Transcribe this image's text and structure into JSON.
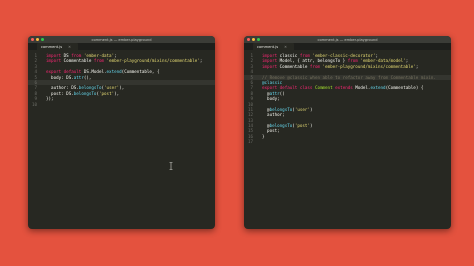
{
  "left_window": {
    "title": "comment.js — ember-playground",
    "tab": "comment.js",
    "lines": [
      [
        {
          "t": "import ",
          "c": "kw"
        },
        {
          "t": "DS ",
          "c": "p"
        },
        {
          "t": "from ",
          "c": "kw"
        },
        {
          "t": "'ember-data'",
          "c": "str"
        },
        {
          "t": ";",
          "c": "p"
        }
      ],
      [
        {
          "t": "import ",
          "c": "kw"
        },
        {
          "t": "Commentable ",
          "c": "p"
        },
        {
          "t": "from ",
          "c": "kw"
        },
        {
          "t": "'ember-playground/mixins/commentable'",
          "c": "str"
        },
        {
          "t": ";",
          "c": "p"
        }
      ],
      [],
      [
        {
          "t": "export default ",
          "c": "kw"
        },
        {
          "t": "DS.Model.",
          "c": "p"
        },
        {
          "t": "extend",
          "c": "fn"
        },
        {
          "t": "(Commentable, {",
          "c": "p"
        }
      ],
      [
        {
          "t": "  body: ",
          "c": "p"
        },
        {
          "t": "DS.",
          "c": "p"
        },
        {
          "t": "attr",
          "c": "fn"
        },
        {
          "t": "(),",
          "c": "p"
        }
      ],
      [],
      [
        {
          "t": "  author: ",
          "c": "p"
        },
        {
          "t": "DS.",
          "c": "p"
        },
        {
          "t": "belongsTo",
          "c": "fn"
        },
        {
          "t": "(",
          "c": "p"
        },
        {
          "t": "'user'",
          "c": "str"
        },
        {
          "t": "),",
          "c": "p"
        }
      ],
      [
        {
          "t": "  post: ",
          "c": "p"
        },
        {
          "t": "DS.",
          "c": "p"
        },
        {
          "t": "belongsTo",
          "c": "fn"
        },
        {
          "t": "(",
          "c": "p"
        },
        {
          "t": "'post'",
          "c": "str"
        },
        {
          "t": "),",
          "c": "p"
        }
      ],
      [
        {
          "t": "});",
          "c": "p"
        }
      ],
      []
    ],
    "highlight_line": 6
  },
  "right_window": {
    "title": "comment.js — ember-playground",
    "tab": "comment.js",
    "lines": [
      [
        {
          "t": "import ",
          "c": "kw"
        },
        {
          "t": "classic ",
          "c": "p"
        },
        {
          "t": "from ",
          "c": "kw"
        },
        {
          "t": "'ember-classic-decorator'",
          "c": "str"
        },
        {
          "t": ";",
          "c": "p"
        }
      ],
      [
        {
          "t": "import ",
          "c": "kw"
        },
        {
          "t": "Model, { attr, belongsTo } ",
          "c": "p"
        },
        {
          "t": "from ",
          "c": "kw"
        },
        {
          "t": "'ember-data/model'",
          "c": "str"
        },
        {
          "t": ";",
          "c": "p"
        }
      ],
      [
        {
          "t": "import ",
          "c": "kw"
        },
        {
          "t": "Commentable ",
          "c": "p"
        },
        {
          "t": "from ",
          "c": "kw"
        },
        {
          "t": "'ember-playground/mixins/commentable'",
          "c": "str"
        },
        {
          "t": ";",
          "c": "p"
        }
      ],
      [],
      [
        {
          "t": "// Remove @classic when able to refactor away from Commentable mixin.",
          "c": "cmt"
        }
      ],
      [
        {
          "t": "@classic",
          "c": "dec"
        }
      ],
      [
        {
          "t": "export default class ",
          "c": "kw"
        },
        {
          "t": "Comment ",
          "c": "fn2"
        },
        {
          "t": "extends ",
          "c": "kw"
        },
        {
          "t": "Model.",
          "c": "p"
        },
        {
          "t": "extend",
          "c": "fn"
        },
        {
          "t": "(Commentable) {",
          "c": "p"
        }
      ],
      [
        {
          "t": "  @",
          "c": "p"
        },
        {
          "t": "attr",
          "c": "dec"
        },
        {
          "t": "()",
          "c": "p"
        }
      ],
      [
        {
          "t": "  body;",
          "c": "p"
        }
      ],
      [],
      [
        {
          "t": "  @",
          "c": "p"
        },
        {
          "t": "belongsTo",
          "c": "dec"
        },
        {
          "t": "(",
          "c": "p"
        },
        {
          "t": "'user'",
          "c": "str"
        },
        {
          "t": ")",
          "c": "p"
        }
      ],
      [
        {
          "t": "  author;",
          "c": "p"
        }
      ],
      [],
      [
        {
          "t": "  @",
          "c": "p"
        },
        {
          "t": "belongsTo",
          "c": "dec"
        },
        {
          "t": "(",
          "c": "p"
        },
        {
          "t": "'post'",
          "c": "str"
        },
        {
          "t": ")",
          "c": "p"
        }
      ],
      [
        {
          "t": "  post;",
          "c": "p"
        }
      ],
      [
        {
          "t": "}",
          "c": "p"
        }
      ],
      []
    ],
    "highlight_line": 5
  },
  "colors": {
    "background": "#e4523e",
    "editor": "#272822",
    "keyword": "#f92672",
    "string": "#e6db74",
    "function": "#66d9ef",
    "comment": "#75715e"
  }
}
